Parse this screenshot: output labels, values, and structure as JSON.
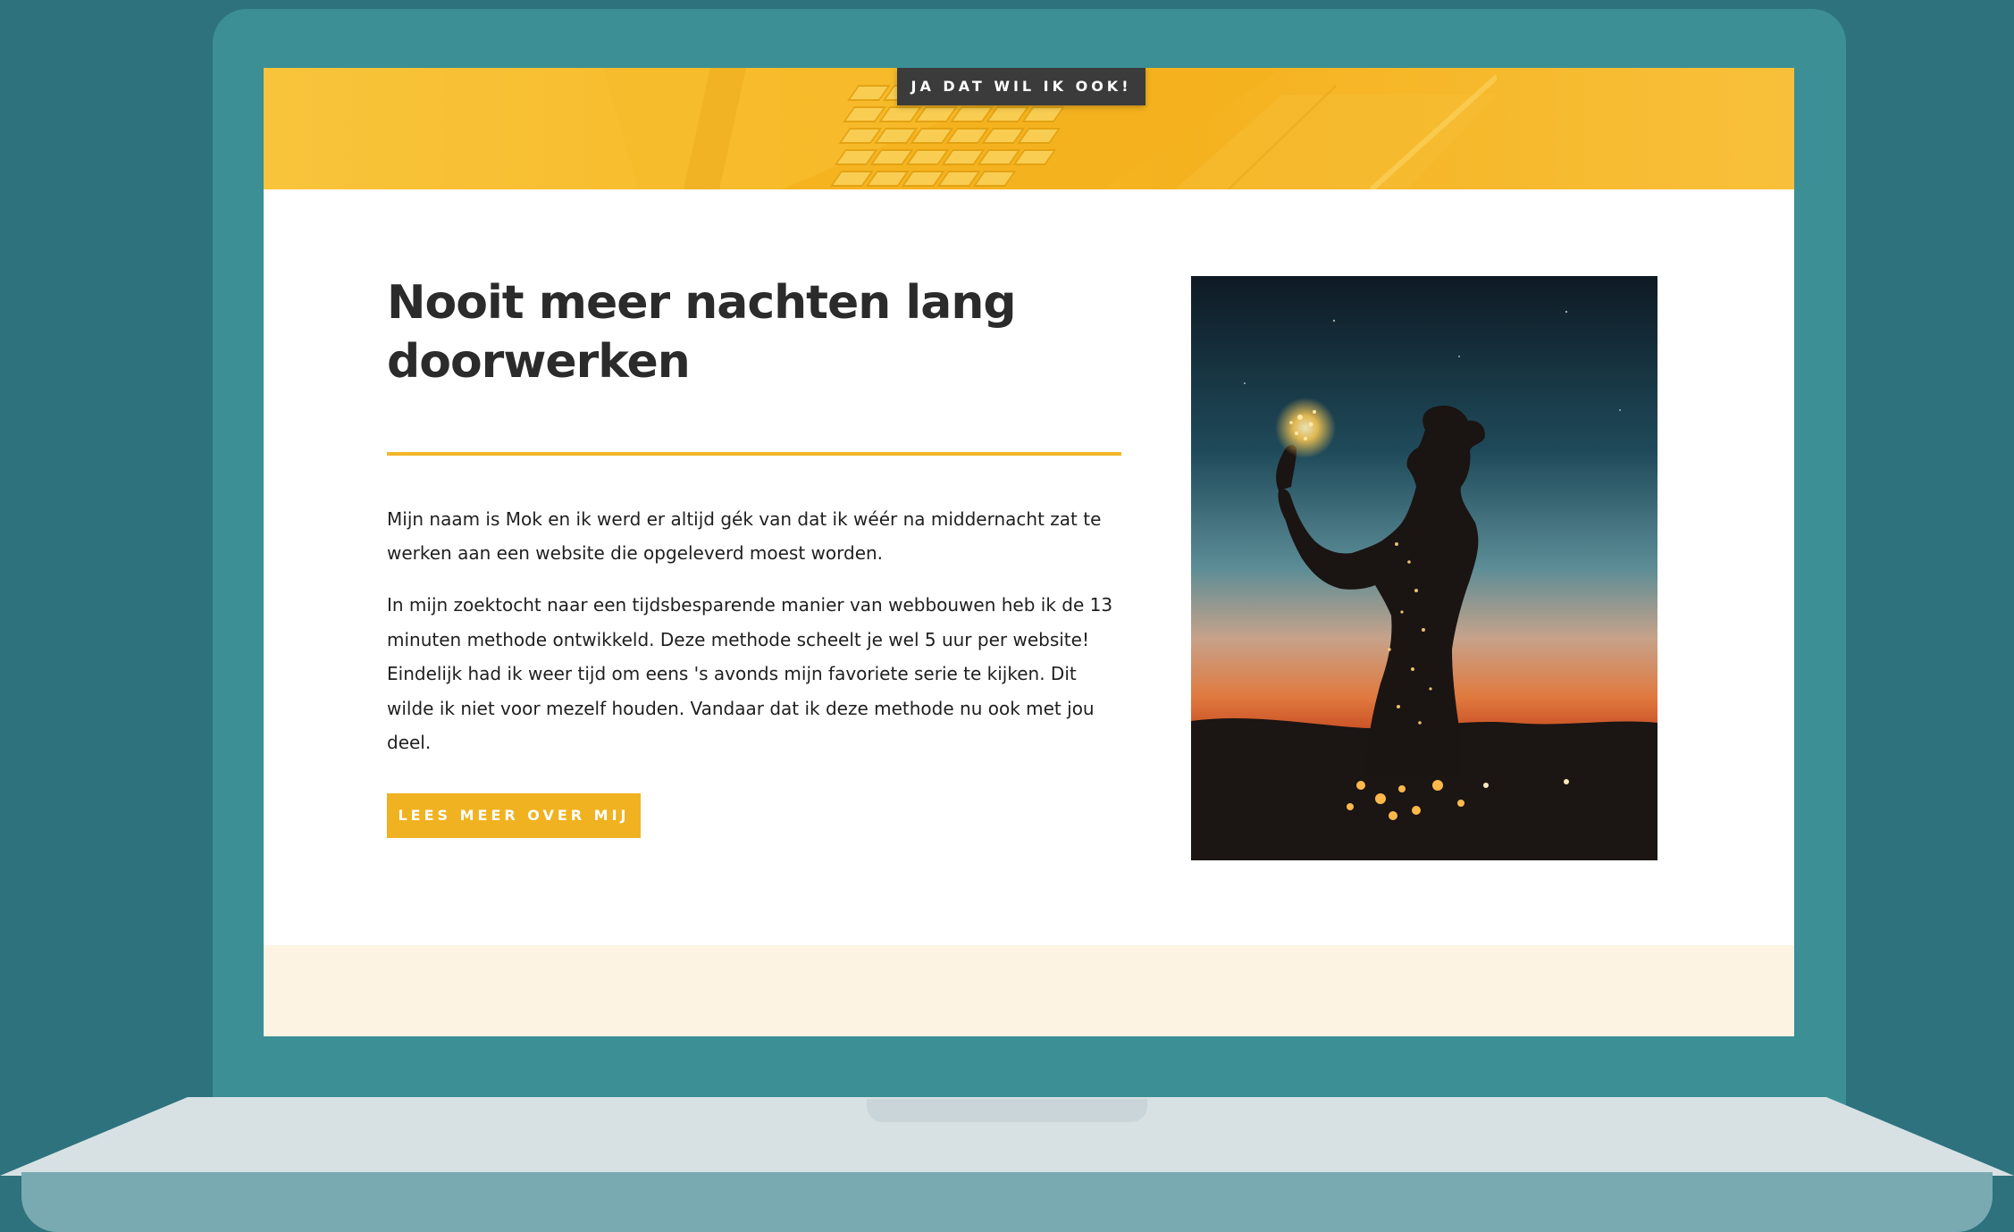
{
  "banner": {
    "cta_label": "JA DAT WIL IK OOK!"
  },
  "main": {
    "title": "Nooit meer nachten lang doorwerken",
    "paragraph_1": "Mijn naam is Mok en ik werd er altijd gék van dat ik wéér na middernacht zat te werken aan een website die opgeleverd moest worden.",
    "paragraph_2": "In mijn zoektocht naar een tijdsbesparende manier van webbouwen heb ik de 13 minuten methode ontwikkeld. Deze methode scheelt je wel 5 uur per website! Eindelijk had ik weer tijd om eens 's avonds mijn favoriete serie te kijken. Dit wilde ik niet voor mezelf houden. Vandaar dat ik deze methode nu ook met jou deel.",
    "button_label": "LEES MEER OVER MIJ"
  },
  "colors": {
    "background": "#2d727d",
    "laptop_lid": "#3b8f95",
    "accent_yellow": "#f0b220",
    "divider": "#f3b62a",
    "bottom_band": "#fcf3e2",
    "dark_button": "#3b3b3b"
  },
  "icons": {
    "photo": "silhouette-woman-with-fairy-lights"
  }
}
